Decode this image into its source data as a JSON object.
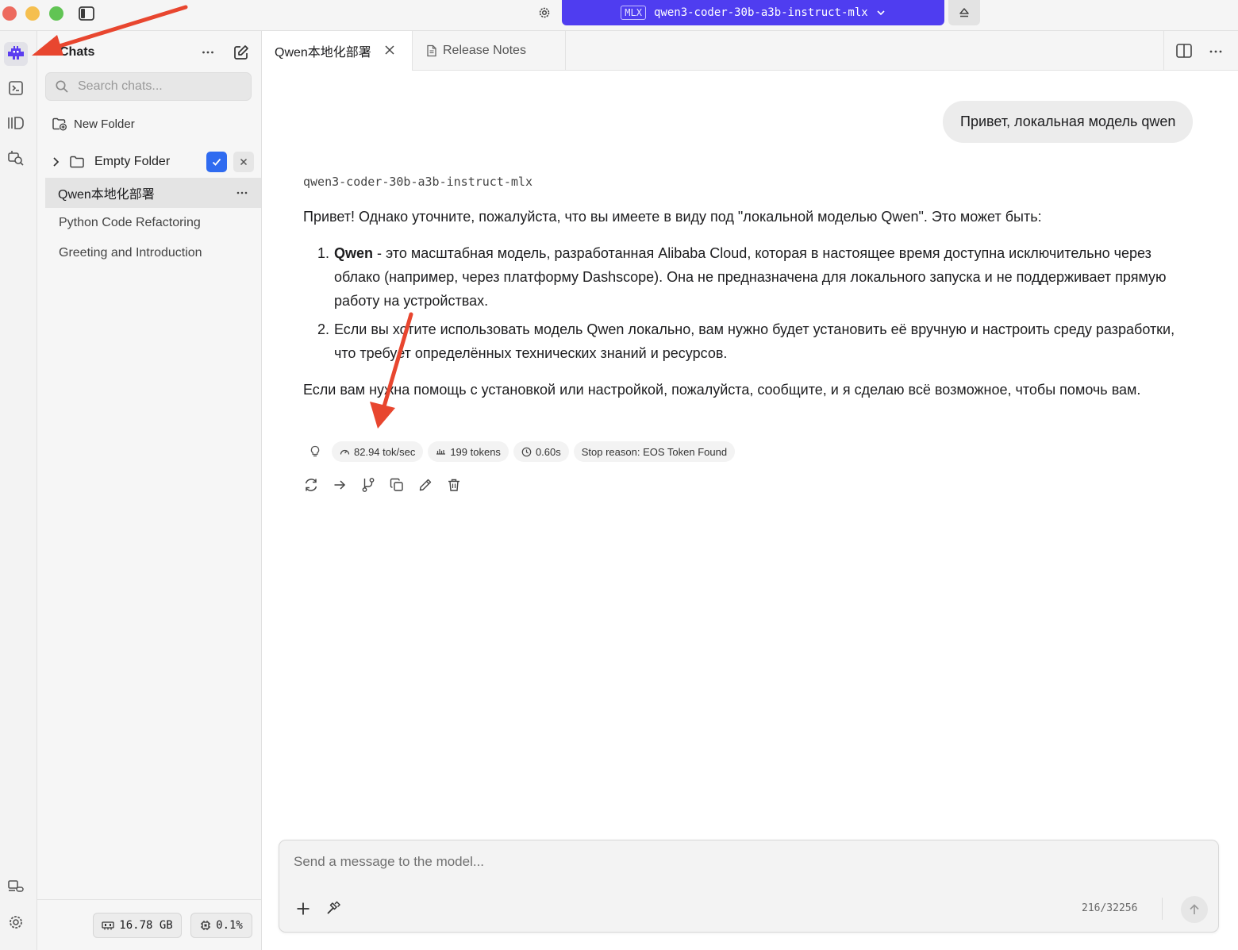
{
  "titlebar": {
    "model_badge": "MLX",
    "model_name": "qwen3-coder-30b-a3b-instruct-mlx",
    "icons": [
      "sidebar-toggle-icon",
      "gear-icon",
      "chevron-down-icon",
      "eject-icon"
    ]
  },
  "activity_bar": {
    "items": [
      {
        "name": "chats",
        "icon": "robot-icon"
      },
      {
        "name": "terminal",
        "icon": "terminal-icon"
      },
      {
        "name": "models",
        "icon": "library-icon"
      },
      {
        "name": "discover",
        "icon": "search-magnify-icon"
      },
      {
        "name": "connections",
        "icon": "link-icon"
      },
      {
        "name": "settings",
        "icon": "gear-icon"
      }
    ]
  },
  "sidebar": {
    "title": "Chats",
    "search_placeholder": "Search chats...",
    "new_folder_label": "New Folder",
    "folder": {
      "label": "Empty Folder"
    },
    "chats": [
      {
        "title": "Qwen本地化部署",
        "selected": true
      },
      {
        "title": "Python Code Refactoring",
        "selected": false
      },
      {
        "title": "Greeting and Introduction",
        "selected": false
      }
    ],
    "memory": "16.78 GB",
    "cpu": "0.1%"
  },
  "tabs": [
    {
      "label": "Qwen本地化部署",
      "active": true
    },
    {
      "label": "Release Notes",
      "active": false
    }
  ],
  "conversation": {
    "user_message": "Привет, локальная модель qwen",
    "assistant_model": "qwen3-coder-30b-a3b-instruct-mlx",
    "answer": {
      "intro": "Привет! Однако уточните, пожалуйста, что вы имеете в виду под \"локальной моделью Qwen\". Это может быть:",
      "item1_bold": "Qwen",
      "item1_text": " - это масштабная модель, разработанная Alibaba Cloud, которая в настоящее время доступна исключительно через облако (например, через платформу Dashscope). Она не предназначена для локального запуска и не поддерживает прямую работу на устройствах.",
      "item2_text": "Если вы хотите использовать модель Qwen локально, вам нужно будет установить её вручную и настроить среду разработки, что требует определённых технических знаний и ресурсов.",
      "outro": "Если вам нужна помощь с установкой или настройкой, пожалуйста, сообщите, и я сделаю всё возможное, чтобы помочь вам."
    },
    "stats": {
      "speed": "82.94 tok/sec",
      "tokens": "199 tokens",
      "time": "0.60s",
      "stop_reason": "Stop reason: EOS Token Found"
    },
    "actions": [
      "regenerate-icon",
      "continue-icon",
      "branch-icon",
      "copy-icon",
      "edit-icon",
      "delete-icon"
    ]
  },
  "composer": {
    "placeholder": "Send a message to the model...",
    "token_count": "216/32256"
  },
  "colors": {
    "accent": "#4f3df0",
    "annotation_arrow": "#e8462f",
    "confirm_blue": "#2f6bf0"
  }
}
